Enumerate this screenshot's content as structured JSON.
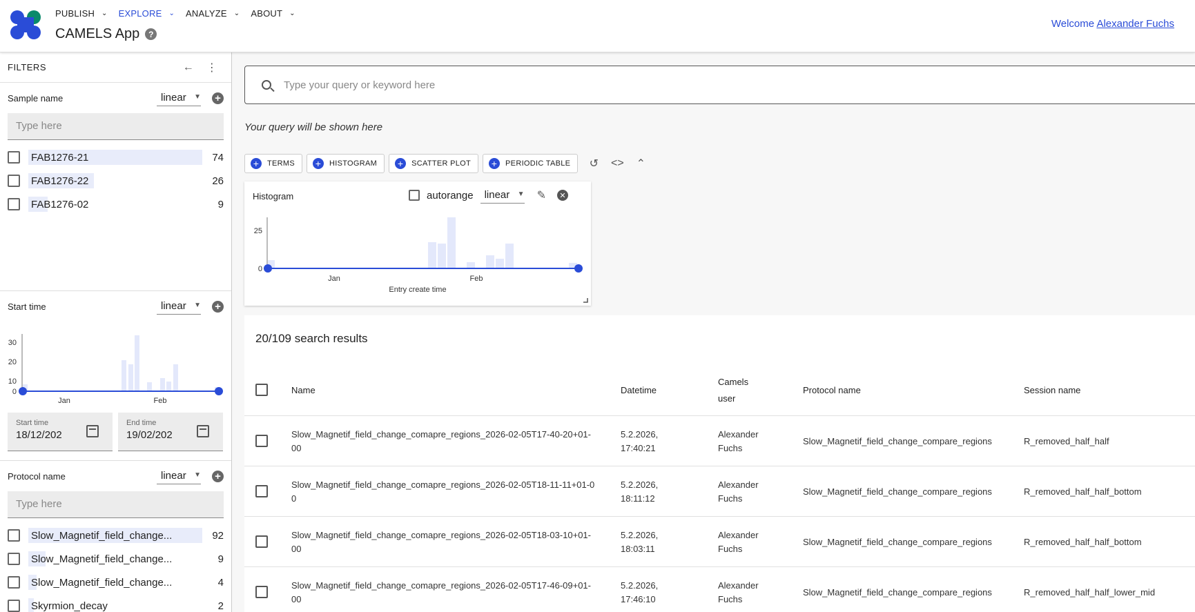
{
  "header": {
    "nav": [
      {
        "label": "PUBLISH"
      },
      {
        "label": "EXPLORE"
      },
      {
        "label": "ANALYZE"
      },
      {
        "label": "ABOUT"
      }
    ],
    "app_title": "CAMELS App",
    "help_glyph": "?",
    "welcome_prefix": "Welcome",
    "user_name": "Alexander Fuchs",
    "accent_color": "#2a4cd7"
  },
  "sidebar": {
    "title": "FILTERS",
    "sample_name": {
      "label": "Sample name",
      "scale": "linear",
      "placeholder": "Type here",
      "options": [
        {
          "name": "FAB1276-21",
          "count": "74",
          "fraction": 1.0
        },
        {
          "name": "FAB1276-22",
          "count": "26",
          "fraction": 0.37
        },
        {
          "name": "FAB1276-02",
          "count": "9",
          "fraction": 0.11
        }
      ]
    },
    "start_time": {
      "label": "Start time",
      "scale": "linear",
      "y_ticks": [
        "30",
        "20",
        "10",
        "0"
      ],
      "x_ticks": [
        "Jan",
        "Feb"
      ],
      "start_label": "Start time",
      "start_value": "18/12/202",
      "end_label": "End time",
      "end_value": "19/02/202"
    },
    "protocol_name": {
      "label": "Protocol name",
      "scale": "linear",
      "placeholder": "Type here",
      "options": [
        {
          "name": "Slow_Magnetif_field_change...",
          "count": "92",
          "fraction": 1.0
        },
        {
          "name": "Slow_Magnetif_field_change...",
          "count": "9",
          "fraction": 0.1
        },
        {
          "name": "Slow_Magnetif_field_change...",
          "count": "4",
          "fraction": 0.05
        },
        {
          "name": "Skyrmion_decay",
          "count": "2",
          "fraction": 0.03
        }
      ]
    }
  },
  "main": {
    "search_placeholder": "Type your query or keyword here",
    "query_hint": "Your query will be shown here",
    "toolbar": [
      {
        "label": "TERMS"
      },
      {
        "label": "HISTOGRAM"
      },
      {
        "label": "SCATTER PLOT"
      },
      {
        "label": "PERIODIC TABLE"
      }
    ],
    "histogram": {
      "title": "Histogram",
      "autorange_label": "autorange",
      "scale": "linear",
      "y_ticks": [
        "25",
        "0"
      ],
      "x_ticks": [
        "Jan",
        "Feb"
      ],
      "xlabel": "Entry create time"
    },
    "results": {
      "title": "20/109 search results",
      "columns": [
        "Name",
        "Datetime",
        "Camels user",
        "Protocol name",
        "Session name"
      ],
      "rows": [
        {
          "name": "Slow_Magnetif_field_change_comapre_regions_2026-02-05T17-40-20+01-00",
          "datetime": "5.2.2026, 17:40:21",
          "user": "Alexander Fuchs",
          "protocol": "Slow_Magnetif_field_change_compare_regions",
          "session": "R_removed_half_half"
        },
        {
          "name": "Slow_Magnetif_field_change_comapre_regions_2026-02-05T18-11-11+01-00",
          "datetime": "5.2.2026, 18:11:12",
          "user": "Alexander Fuchs",
          "protocol": "Slow_Magnetif_field_change_compare_regions",
          "session": "R_removed_half_half_bottom"
        },
        {
          "name": "Slow_Magnetif_field_change_comapre_regions_2026-02-05T18-03-10+01-00",
          "datetime": "5.2.2026, 18:03:11",
          "user": "Alexander Fuchs",
          "protocol": "Slow_Magnetif_field_change_compare_regions",
          "session": "R_removed_half_half_bottom"
        },
        {
          "name": "Slow_Magnetif_field_change_comapre_regions_2026-02-05T17-46-09+01-00",
          "datetime": "5.2.2026, 17:46:10",
          "user": "Alexander Fuchs",
          "protocol": "Slow_Magnetif_field_change_compare_regions",
          "session": "R_removed_half_half_lower_mid"
        }
      ]
    }
  }
}
